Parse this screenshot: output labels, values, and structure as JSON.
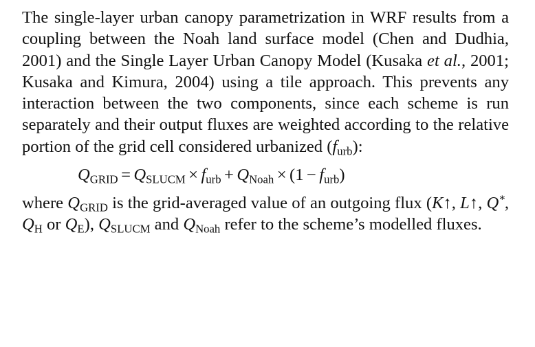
{
  "paragraph1": {
    "t1": "The single-layer urban canopy parametrization in WRF results from a coupling between the Noah land surface model (Chen and Dudhia, 2001) and the Single Layer Urban Canopy Model (Kusaka ",
    "et_al": "et al.",
    "t2": ", 2001; Kusaka and Kimura, 2004) using a tile approach. This prevents any interaction between the two components, since each scheme is run separately and their output fluxes are weighted according to the relative portion of the grid cell considered urbanized (",
    "f": "f",
    "f_sub": "urb",
    "t3": "):"
  },
  "equation": {
    "Q": "Q",
    "grid_sub": "GRID",
    "equals": "=",
    "slucm_sub": "SLUCM",
    "times": "×",
    "f": "f",
    "urb_sub": "urb",
    "plus": "+",
    "noah_sub": "Noah",
    "open": "(1",
    "minus": "−",
    "close": ")"
  },
  "paragraph2": {
    "where": "where ",
    "Q": "Q",
    "grid_sub": "GRID",
    "t1": " is the grid-averaged value of an outgoing flux (",
    "K": "K",
    "arrow": "↑",
    "comma": ", ",
    "L": "L",
    "star": "*",
    "H_sub": "H",
    "or": " or ",
    "E_sub": "E",
    "t2": "), ",
    "slucm_sub": "SLUCM",
    "and": " and ",
    "noah_sub": "Noah",
    "t3": " refer to the scheme’s modelled fluxes."
  }
}
